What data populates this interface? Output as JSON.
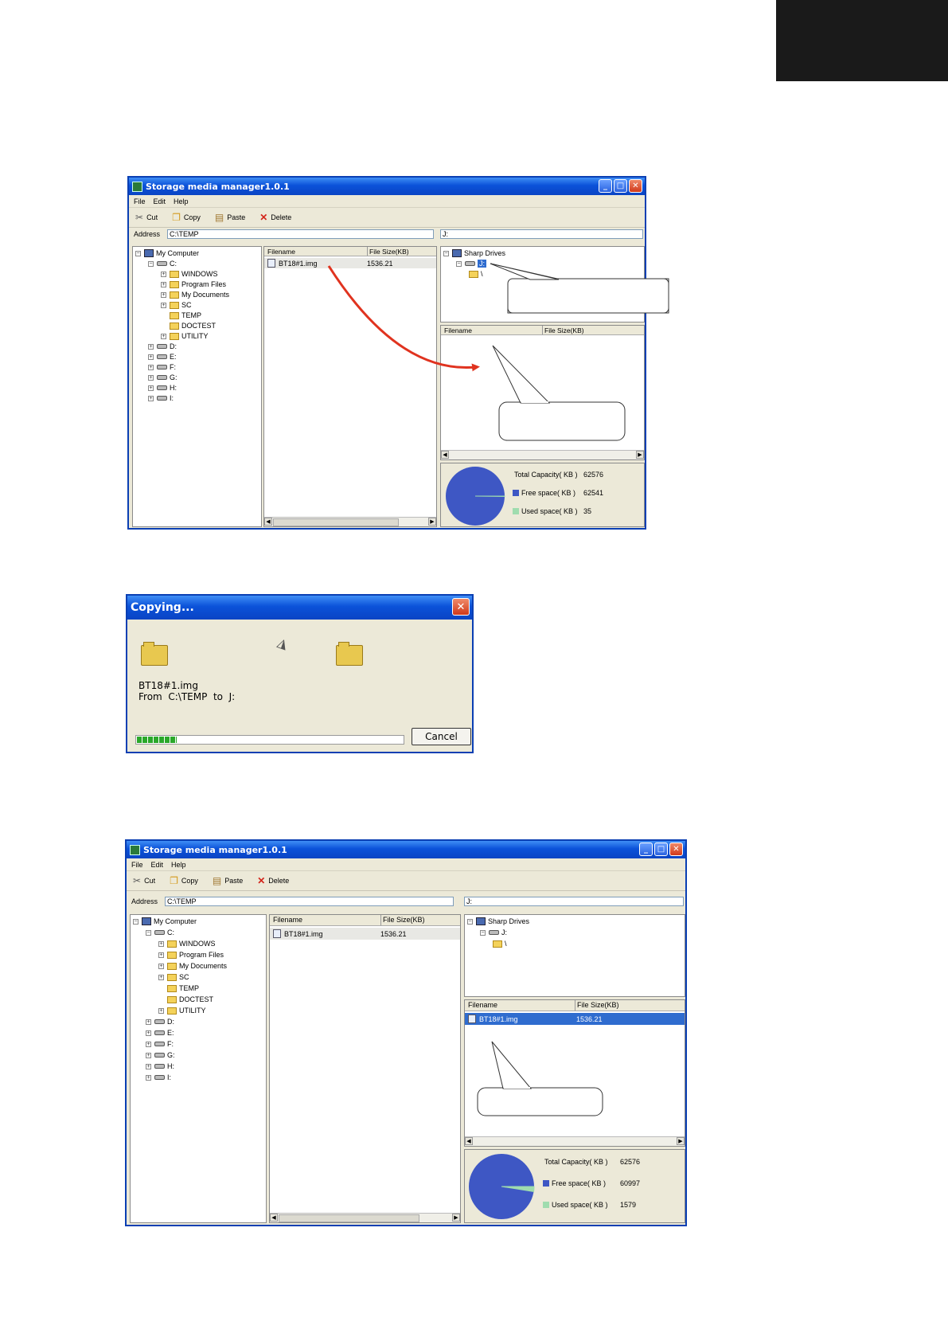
{
  "window": {
    "title": "Storage media manager1.0.1",
    "menu": [
      "File",
      "Edit",
      "Help"
    ],
    "toolbar": {
      "cut": "Cut",
      "copy": "Copy",
      "paste": "Paste",
      "delete": "Delete"
    },
    "address_label": "Address",
    "address_value": "C:\\TEMP",
    "right_address": "J:",
    "tree": {
      "root": "My Computer",
      "c_drive": "C:",
      "folders": [
        "WINDOWS",
        "Program Files",
        "My Documents",
        "SC",
        "TEMP",
        "DOCTEST",
        "UTILITY"
      ],
      "drives": [
        "D:",
        "E:",
        "F:",
        "G:",
        "H:",
        "I:"
      ]
    },
    "columns": {
      "filename": "Filename",
      "size": "File Size(KB)"
    },
    "local_file": {
      "name": "BT18#1.img",
      "size": "1536.21"
    },
    "sharp_tree": {
      "root": "Sharp Drives",
      "drive": "J:",
      "folder": "\\"
    },
    "capacity_labels": {
      "total": "Total Capacity( KB )",
      "free": "Free space( KB )",
      "used": "Used space( KB )"
    },
    "colors": {
      "free": "#3e57c4",
      "used": "#9fdcae",
      "title": "#0b52d9",
      "arrow": "#e0331f"
    }
  },
  "before": {
    "capacity": {
      "total": "62576",
      "free": "62541",
      "used": "35"
    },
    "free_fraction": 0.99944
  },
  "after": {
    "sharp_file": {
      "name": "BT18#1.img",
      "size": "1536.21"
    },
    "capacity": {
      "total": "62576",
      "free": "60997",
      "used": "1579"
    },
    "free_fraction": 0.97477
  },
  "copy_dialog": {
    "title": "Copying...",
    "filename": "BT18#1.img",
    "from_line": "From  C:\\TEMP  to  J:",
    "cancel": "Cancel",
    "progress_fraction": 0.15
  }
}
